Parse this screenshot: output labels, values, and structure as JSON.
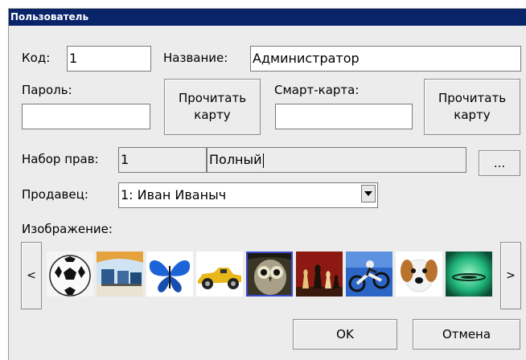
{
  "dialog": {
    "title": "Пользователь"
  },
  "form": {
    "code_label": "Код:",
    "code_value": "1",
    "name_label": "Название:",
    "name_value": "Администратор",
    "password_label": "Пароль:",
    "password_value": "",
    "read_card_label": "Прочитать карту",
    "smartcard_label": "Смарт-карта:",
    "smartcard_value": "",
    "read_card2_label": "Прочитать карту",
    "rights_label": "Набор прав:",
    "rights_id": "1",
    "rights_name": "Полный",
    "rights_browse_label": "...",
    "seller_label": "Продавец:",
    "seller_value": "1: Иван Иваныч",
    "image_label": "Изображение:"
  },
  "gallery": {
    "prev_label": "<",
    "next_label": ">",
    "images": [
      "soccer-ball",
      "beach-chairs",
      "blue-butterfly",
      "race-car",
      "owl",
      "chess-pieces",
      "motocross-rider",
      "dog",
      "green-water-drop"
    ],
    "selected_index": 4
  },
  "footer": {
    "ok_label": "OK",
    "cancel_label": "Отмена"
  },
  "colors": {
    "titlebar": "#0a246a",
    "dialog_bg": "#ececec",
    "selection": "#3b47c9"
  }
}
